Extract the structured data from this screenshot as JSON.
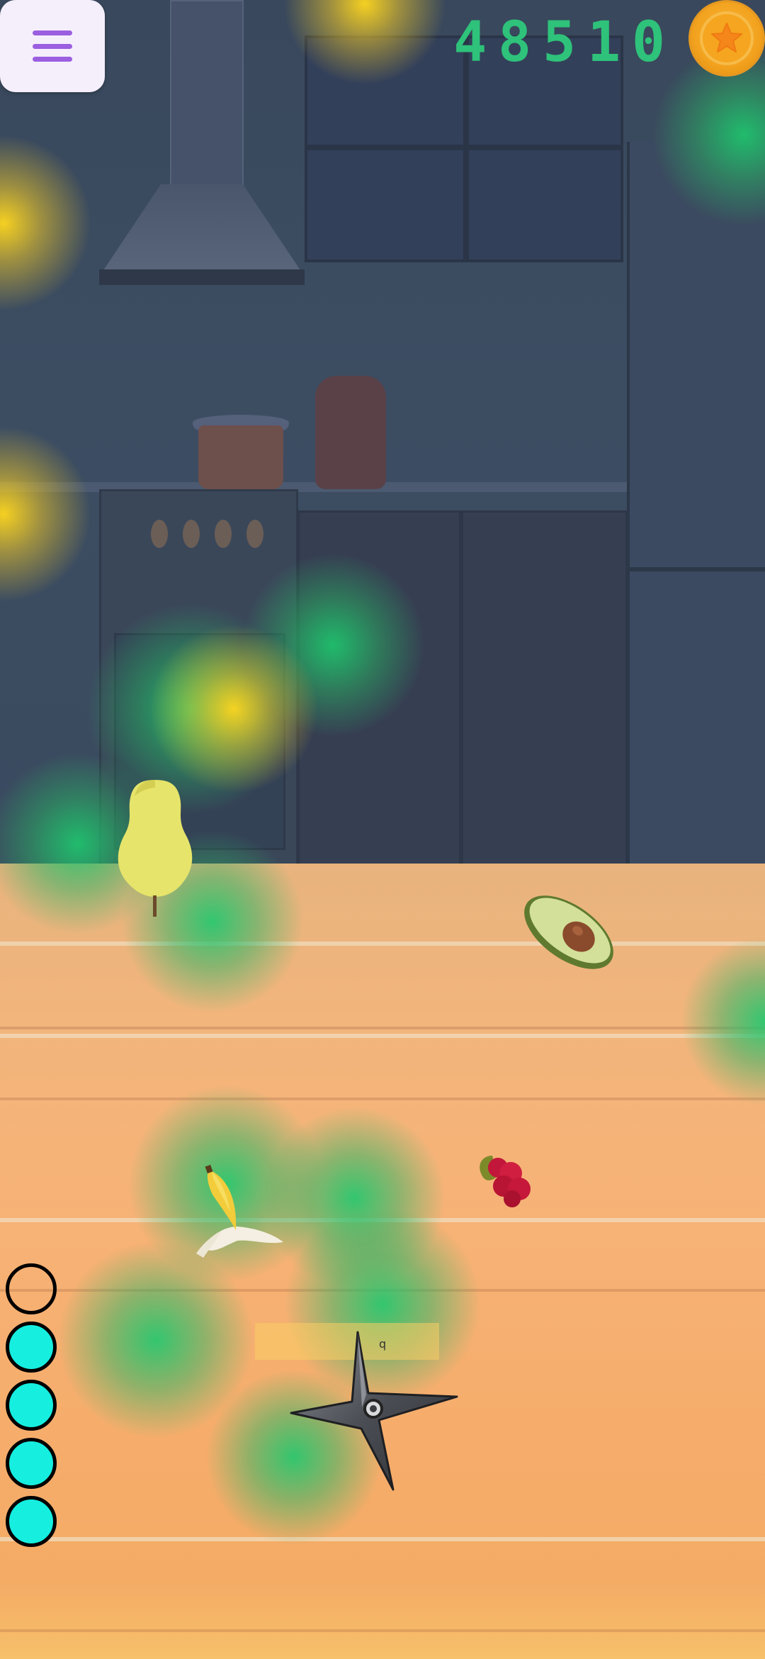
{
  "hud": {
    "menu_icon": "hamburger-menu-icon",
    "score": "48510",
    "coin_icon": "star-coin-icon",
    "lives": [
      {
        "state": "empty"
      },
      {
        "state": "full"
      },
      {
        "state": "full"
      },
      {
        "state": "full"
      },
      {
        "state": "full"
      }
    ],
    "lives_remaining": 4,
    "lives_total": 5
  },
  "throwable": {
    "icon": "shuriken-icon",
    "key_hint": "q"
  },
  "objects": [
    {
      "name": "pear",
      "icon": "pear-icon"
    },
    {
      "name": "avocado-half",
      "icon": "avocado-icon"
    },
    {
      "name": "banana-peeled",
      "icon": "banana-icon"
    },
    {
      "name": "raspberry",
      "icon": "raspberry-icon"
    }
  ],
  "colors": {
    "score_text": "#2ec27a",
    "menu_bars": "#9b5fe0",
    "life_full": "#16eee0",
    "coin": "#f2a21e"
  }
}
